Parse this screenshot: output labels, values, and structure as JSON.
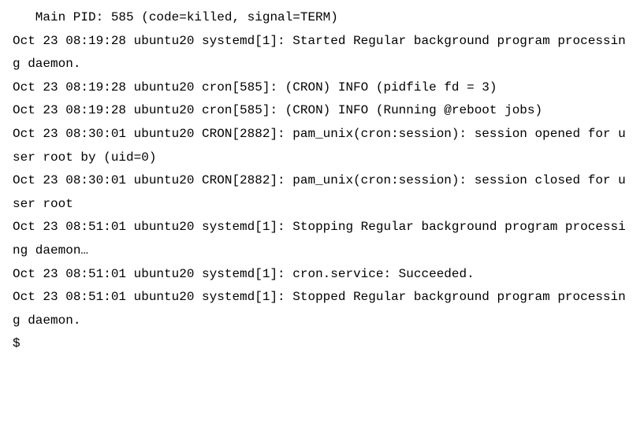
{
  "header": {
    "main_pid_line": "Main PID: 585 (code=killed, signal=TERM)"
  },
  "log": [
    "Oct 23 08:19:28 ubuntu20 systemd[1]: Started Regular background program processing daemon.",
    "Oct 23 08:19:28 ubuntu20 cron[585]: (CRON) INFO (pidfile fd = 3)",
    "Oct 23 08:19:28 ubuntu20 cron[585]: (CRON) INFO (Running @reboot jobs)",
    "Oct 23 08:30:01 ubuntu20 CRON[2882]: pam_unix(cron:session): session opened for user root by (uid=0)",
    "Oct 23 08:30:01 ubuntu20 CRON[2882]: pam_unix(cron:session): session closed for user root",
    "Oct 23 08:51:01 ubuntu20 systemd[1]: Stopping Regular background program processing daemon…",
    "Oct 23 08:51:01 ubuntu20 systemd[1]: cron.service: Succeeded.",
    "Oct 23 08:51:01 ubuntu20 systemd[1]: Stopped Regular background program processing daemon."
  ],
  "prompt": "$"
}
